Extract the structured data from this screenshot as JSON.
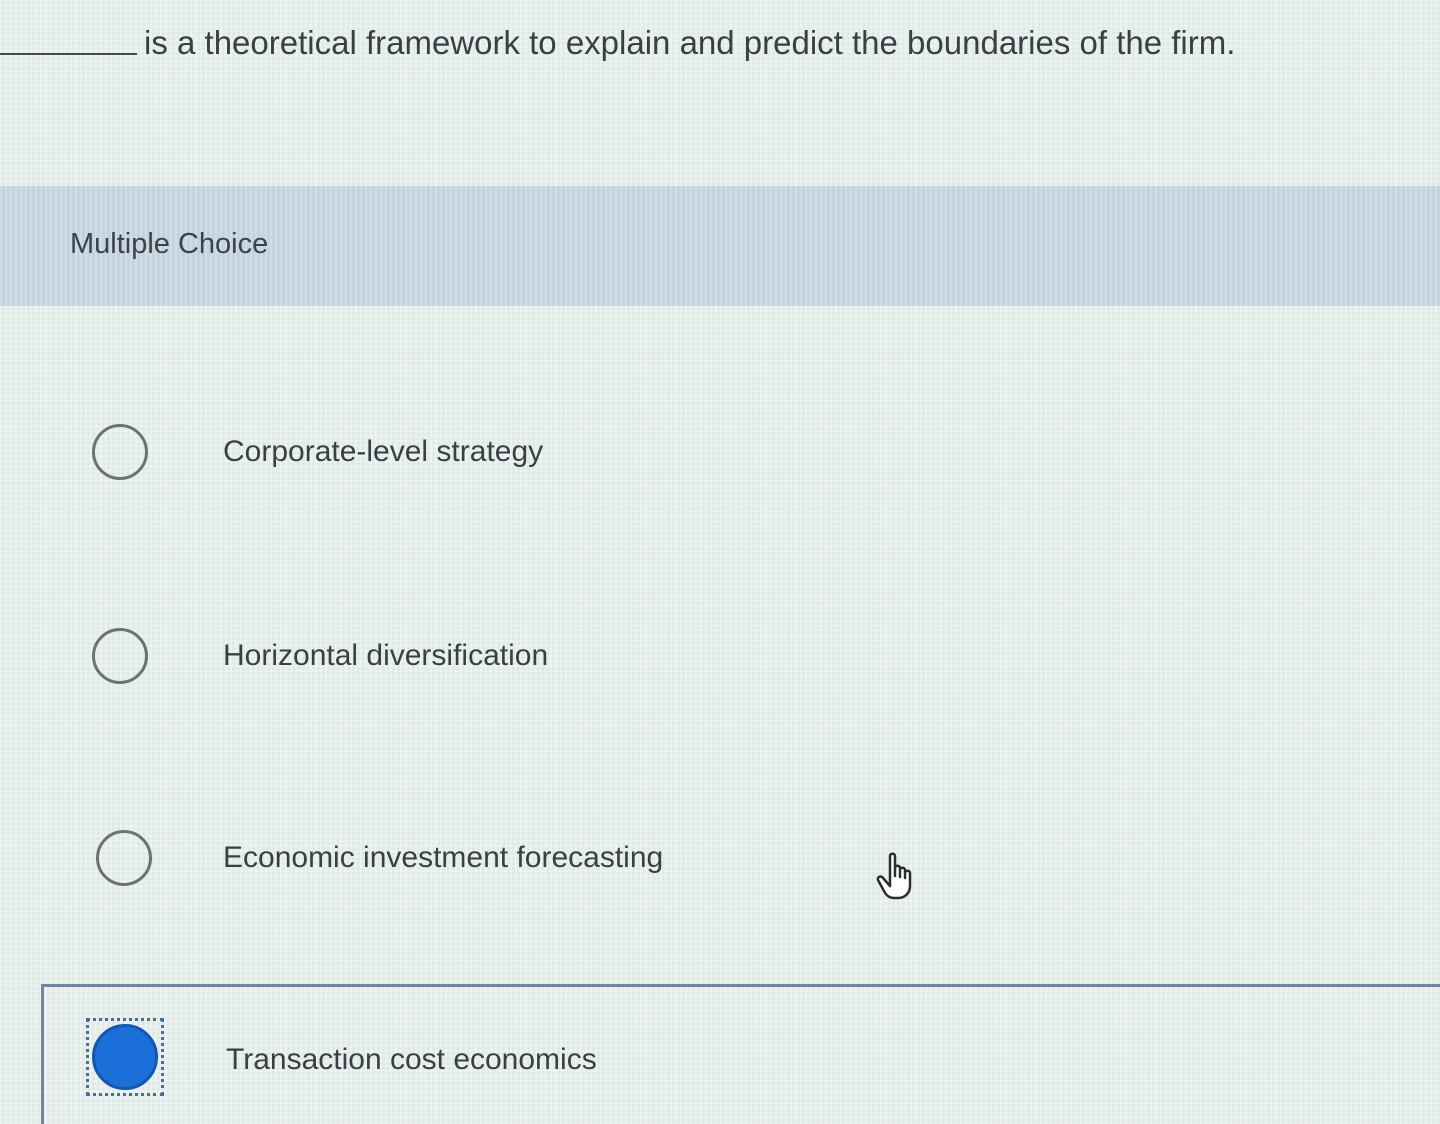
{
  "question": {
    "text": "is a theoretical framework to explain and predict the boundaries of the firm."
  },
  "section": {
    "label": "Multiple Choice"
  },
  "options": [
    {
      "label": "Corporate-level strategy",
      "selected": false
    },
    {
      "label": "Horizontal diversification",
      "selected": false
    },
    {
      "label": "Economic investment forecasting",
      "selected": false
    },
    {
      "label": "Transaction cost economics",
      "selected": true
    }
  ],
  "colors": {
    "selected_radio": "#1b6fd8",
    "header_band": "#c3d4e0",
    "text": "#3a3f44"
  },
  "icons": {
    "cursor": "hand-pointer-icon"
  }
}
